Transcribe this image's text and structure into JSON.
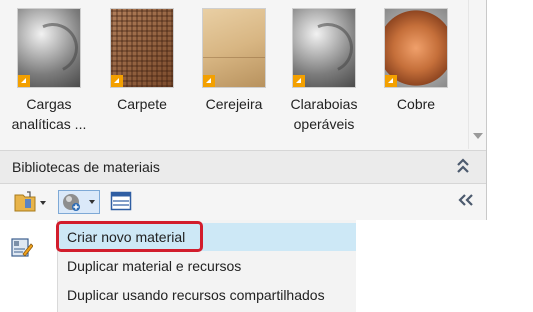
{
  "materials": [
    {
      "label_line1": "Cargas",
      "label_line2": "analíticas ...",
      "swatch": "gray-sphere"
    },
    {
      "label_line1": "Carpete",
      "label_line2": "",
      "swatch": "carpet-cube"
    },
    {
      "label_line1": "Cerejeira",
      "label_line2": "",
      "swatch": "cherry-wood-cube"
    },
    {
      "label_line1": "Claraboias",
      "label_line2": "operáveis",
      "swatch": "gray-sphere"
    },
    {
      "label_line1": "Cobre",
      "label_line2": "",
      "swatch": "copper-sphere"
    }
  ],
  "library_header": {
    "title": "Bibliotecas de materiais",
    "collapse_icon": "double-chevron-up-icon"
  },
  "toolbar": {
    "expand_icon": "double-chevron-left-icon"
  },
  "menu": {
    "items": [
      {
        "label": "Criar novo material",
        "highlighted": true
      },
      {
        "label": "Duplicar material e recursos",
        "highlighted": false
      },
      {
        "label": "Duplicar usando recursos compartilhados",
        "highlighted": false
      }
    ]
  },
  "colors": {
    "highlight": "#cde8f6",
    "outline_red": "#d21d2c",
    "badge_orange": "#f3a000"
  }
}
